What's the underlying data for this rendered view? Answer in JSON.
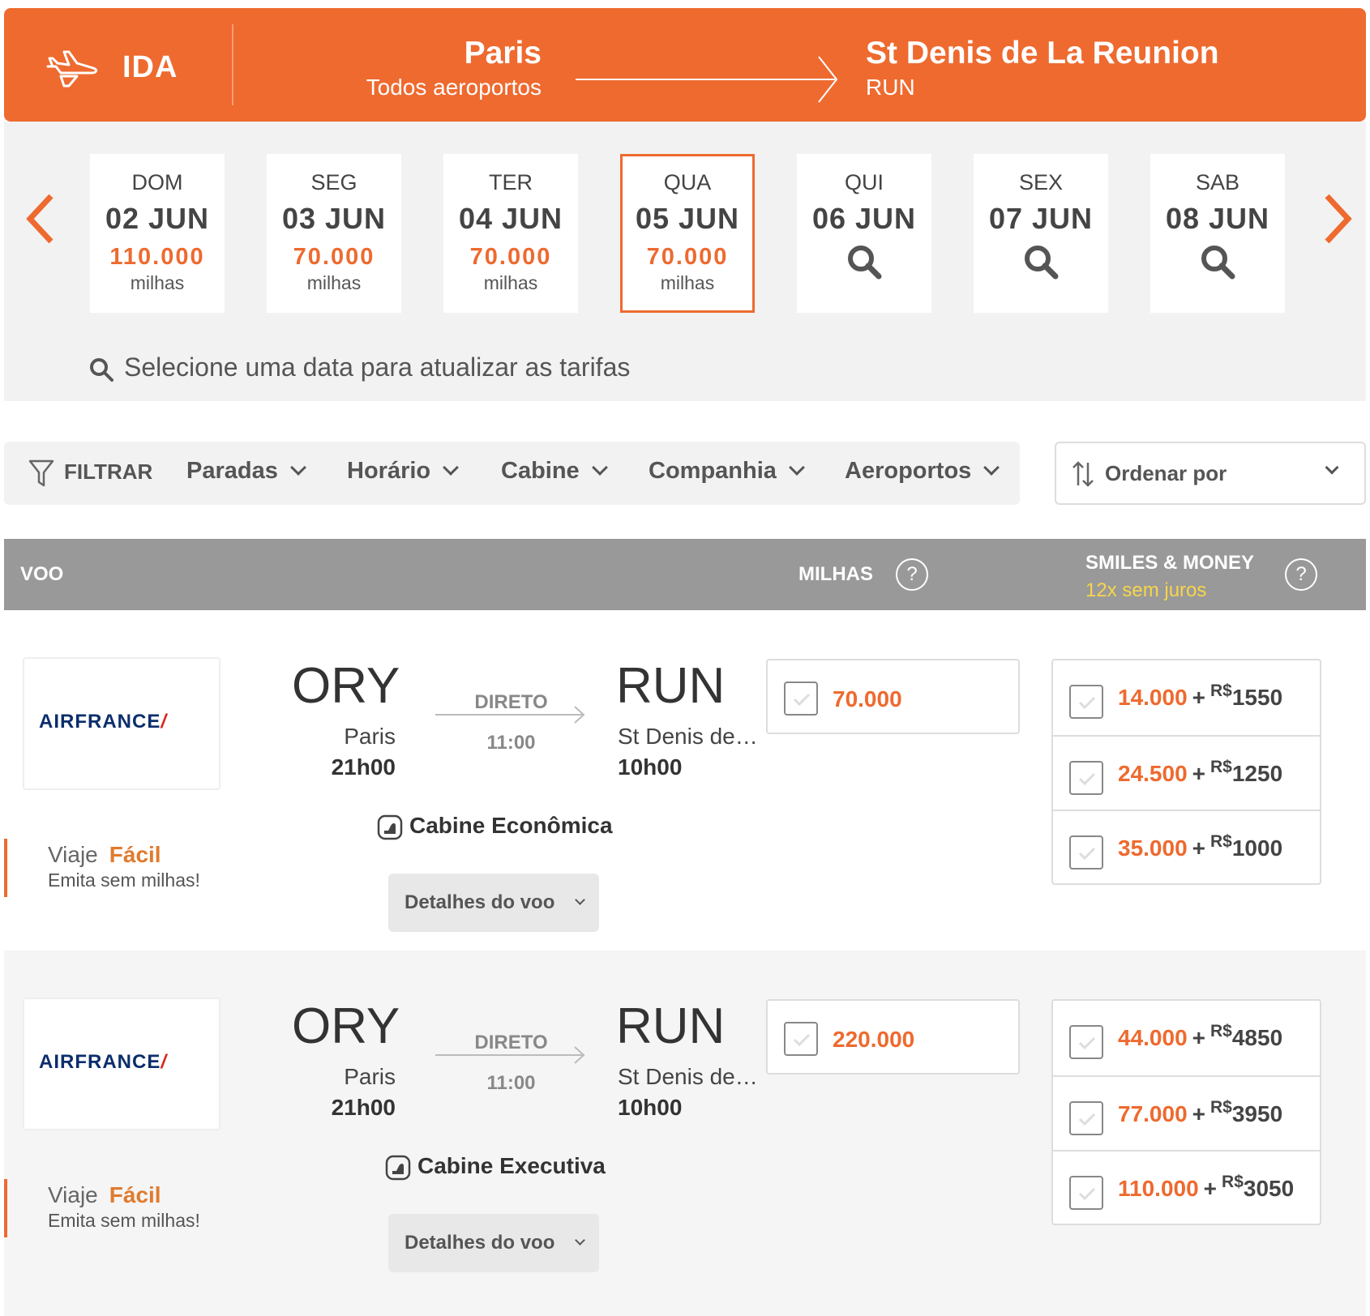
{
  "header": {
    "direction_label": "IDA",
    "origin_city": "Paris",
    "origin_sub": "Todos aeroportos",
    "dest_city": "St Denis de La Reunion",
    "dest_sub": "RUN",
    "bg_color": "#ee6a2f"
  },
  "calendar": {
    "days": [
      {
        "dow": "DOM",
        "date": "02 JUN",
        "price": "110.000",
        "unit": "milhas"
      },
      {
        "dow": "SEG",
        "date": "03 JUN",
        "price": "70.000",
        "unit": "milhas"
      },
      {
        "dow": "TER",
        "date": "04 JUN",
        "price": "70.000",
        "unit": "milhas"
      },
      {
        "dow": "QUA",
        "date": "05 JUN",
        "price": "70.000",
        "unit": "milhas"
      },
      {
        "dow": "QUI",
        "date": "06 JUN"
      },
      {
        "dow": "SEX",
        "date": "07 JUN"
      },
      {
        "dow": "SAB",
        "date": "08 JUN"
      }
    ],
    "hint": "Selecione uma data para atualizar as tarifas"
  },
  "filters": {
    "label": "FILTRAR",
    "items": [
      "Paradas",
      "Horário",
      "Cabine",
      "Companhia",
      "Aeroportos"
    ],
    "sort_label": "Ordenar por"
  },
  "table_header": {
    "voo": "VOO",
    "milhas": "MILHAS",
    "smiles": "SMILES & MONEY",
    "installments": "12x sem juros",
    "help": "?"
  },
  "flights": [
    {
      "airline": "AIRFRANCE",
      "dep_code": "ORY",
      "dep_city": "Paris",
      "dep_time": "21h00",
      "stops": "DIRETO",
      "duration": "11:00",
      "arr_code": "RUN",
      "arr_city": "St Denis de La Reunion",
      "arr_time": "10h00",
      "cabin": "Cabine Econômica",
      "details": "Detalhes do voo",
      "viaje": "Viaje",
      "facil": "Fácil",
      "viaje_sub": "Emita sem milhas!",
      "milhas": "70.000",
      "options": [
        {
          "miles": "14.000",
          "currency": "R$",
          "money": "1550"
        },
        {
          "miles": "24.500",
          "currency": "R$",
          "money": "1250"
        },
        {
          "miles": "35.000",
          "currency": "R$",
          "money": "1000"
        }
      ]
    },
    {
      "airline": "AIRFRANCE",
      "dep_code": "ORY",
      "dep_city": "Paris",
      "dep_time": "21h00",
      "stops": "DIRETO",
      "duration": "11:00",
      "arr_code": "RUN",
      "arr_city": "St Denis de La Reunion",
      "arr_time": "10h00",
      "cabin": "Cabine Executiva",
      "details": "Detalhes do voo",
      "viaje": "Viaje",
      "facil": "Fácil",
      "viaje_sub": "Emita sem milhas!",
      "milhas": "220.000",
      "options": [
        {
          "miles": "44.000",
          "currency": "R$",
          "money": "4850"
        },
        {
          "miles": "77.000",
          "currency": "R$",
          "money": "3950"
        },
        {
          "miles": "110.000",
          "currency": "R$",
          "money": "3050"
        }
      ]
    }
  ]
}
